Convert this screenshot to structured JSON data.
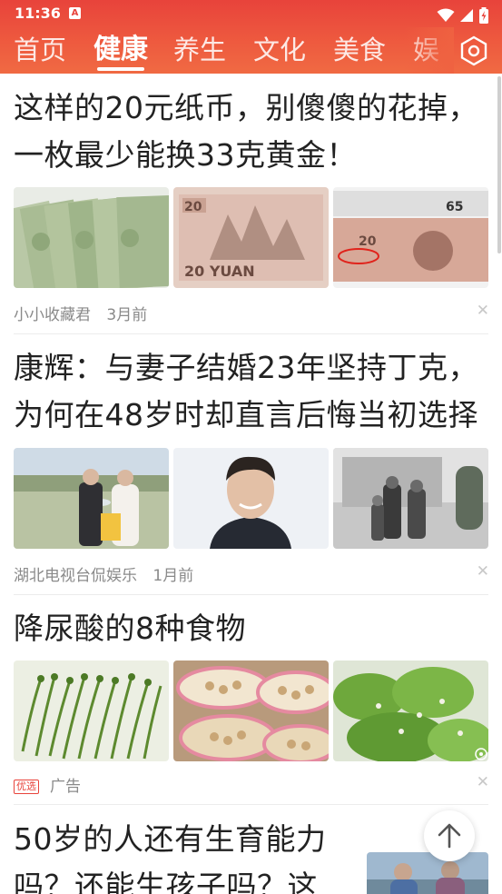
{
  "status_bar": {
    "time": "11:36",
    "notification_letter": "A"
  },
  "nav": {
    "tabs": [
      {
        "label": "首页",
        "active": false
      },
      {
        "label": "健康",
        "active": true
      },
      {
        "label": "养生",
        "active": false
      },
      {
        "label": "文化",
        "active": false
      },
      {
        "label": "美食",
        "active": false
      },
      {
        "label": "娱",
        "active": false
      }
    ],
    "settings_icon": "hexagon-settings-icon"
  },
  "feed": {
    "articles": [
      {
        "title_line1": "这样的20元纸币，别傻傻的花掉，",
        "title_line2": "一枚最少能换33克黄金！",
        "source": "小小收藏君",
        "time": "3月前",
        "thumbs": [
          {
            "caption": ""
          },
          {
            "caption": "20 YUAN"
          },
          {
            "caption": "65"
          }
        ]
      },
      {
        "title_line1": "康辉：与妻子结婚23年坚持丁克，",
        "title_line2": "为何在48岁时却直言后悔当初选择",
        "source": "湖北电视台侃娱乐",
        "time": "1月前"
      },
      {
        "title_line1": "降尿酸的8种食物",
        "ad_badge": "优选",
        "ad_label": "广告"
      },
      {
        "title_line1": "50岁的人还有生育能力",
        "title_line2": "吗？还能生孩子吗？这"
      }
    ]
  },
  "colors": {
    "brand": "#e8433b",
    "nav_end": "#f06a43",
    "meta_text": "#8a8a8a"
  }
}
